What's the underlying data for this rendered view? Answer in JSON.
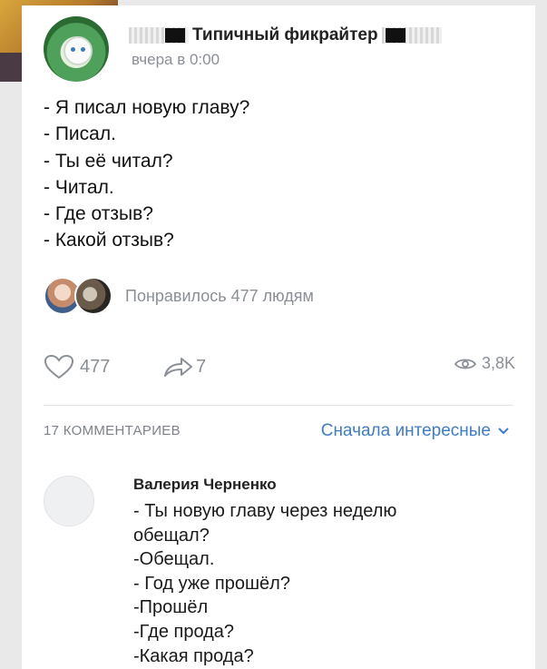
{
  "post": {
    "author": "Типичный фикрайтер",
    "time": "вчера в 0:00",
    "lines": [
      "- Я писал новую главу?",
      "- Писал.",
      "- Ты её читал?",
      "- Читал.",
      "- Где отзыв?",
      "- Какой отзыв?"
    ],
    "liked_text": "Понравилось 477 людям"
  },
  "actions": {
    "likes": "477",
    "shares": "7",
    "views": "3,8K"
  },
  "comments": {
    "count_label": "17 КОММЕНТАРИЕВ",
    "sort_label": "Сначала интересные",
    "items": [
      {
        "author": "Валерия Черненко",
        "lines": [
          "- Ты новую главу через неделю",
          "обещал?",
          "-Обещал.",
          "- Год уже прошёл?",
          "-Прошёл",
          "-Где прода?",
          "-Какая прода?"
        ]
      }
    ]
  },
  "colors": {
    "link": "#3f7cc4",
    "muted": "#8a8f96",
    "text": "#111111"
  },
  "icons": {
    "like": "heart-icon",
    "share": "share-arrow-icon",
    "views": "eye-icon",
    "sort": "chevron-down-icon"
  }
}
